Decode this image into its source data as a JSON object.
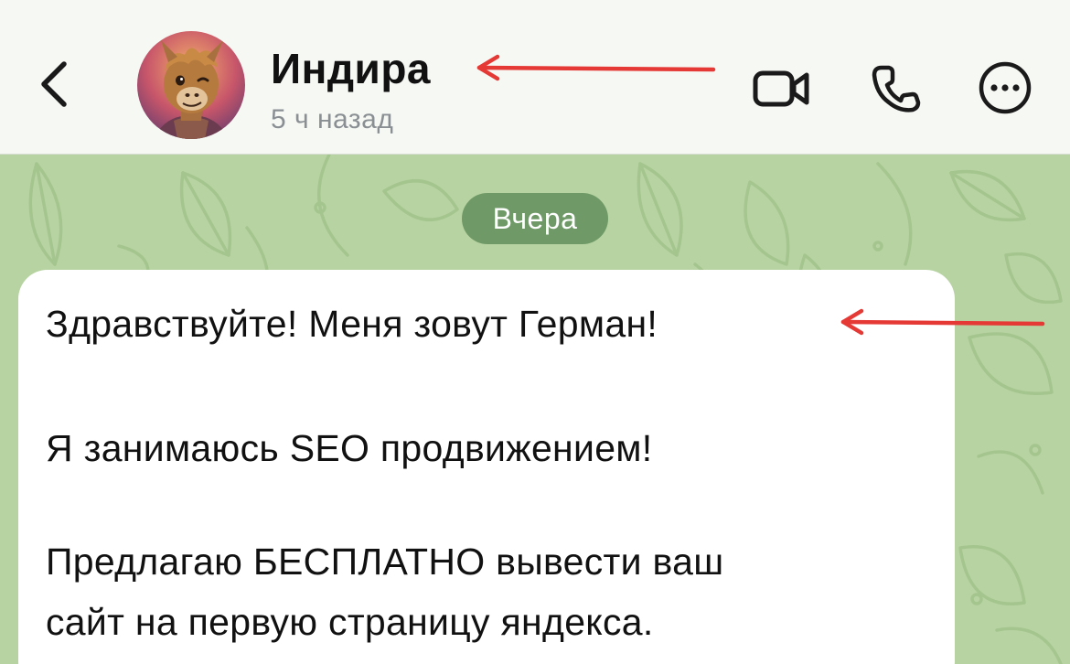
{
  "header": {
    "back_icon": "chevron-left-icon",
    "contact_name": "Индира",
    "status": "5 ч назад",
    "actions": {
      "video_icon": "video-camera-icon",
      "call_icon": "phone-icon",
      "more_icon": "more-circle-icon"
    }
  },
  "chat": {
    "date_separator": "Вчера",
    "message": {
      "lines": [
        "Здравствуйте! Меня зовут Герман!",
        "Я занимаюсь SEO продвижением!",
        "Предлагаю БЕСПЛАТНО вывести ваш",
        "сайт на первую страницу яндекса."
      ]
    }
  },
  "colors": {
    "header_bg": "#f6f8f4",
    "chat_bg": "#b7d3a2",
    "date_pill_bg": "#6f9a67",
    "bubble_bg": "#ffffff",
    "arrow": "#e53935",
    "icon": "#1a1a1a"
  }
}
